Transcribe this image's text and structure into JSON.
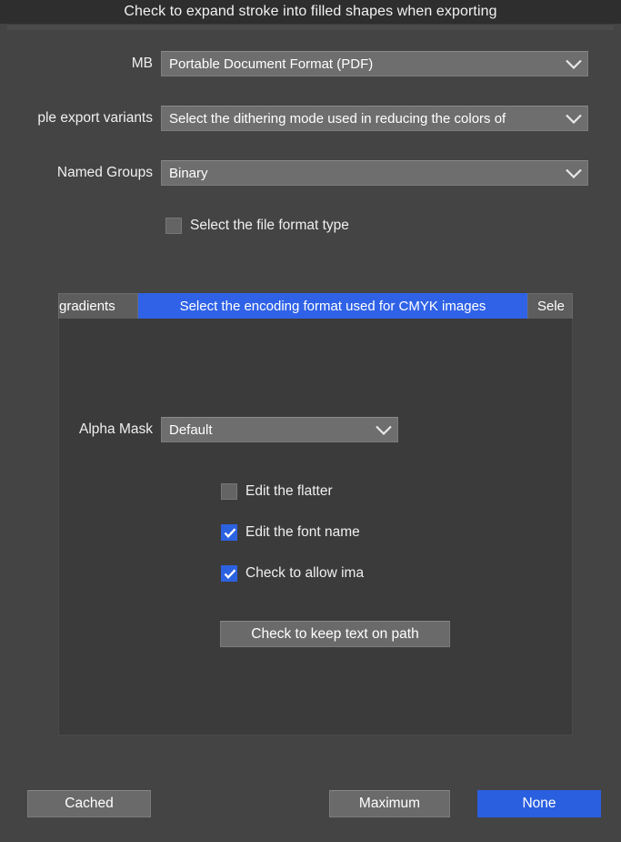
{
  "window": {
    "title": "Check to expand stroke into filled shapes when exporting"
  },
  "theme": {
    "background": "#444444",
    "titlebar_background": "#2e2e2e",
    "control_background": "#6e6e6e",
    "panel_background": "#3b3b3b",
    "accent": "#2a5fe0",
    "tab_active": "#2f62e6",
    "text": "#f0f0f0"
  },
  "form": {
    "rows": [
      {
        "label": "MB",
        "value": "Portable Document Format (PDF)",
        "icon": "chevron-down-icon"
      },
      {
        "label": "ple export variants",
        "value": "Select the dithering mode used in reducing the colors of",
        "icon": "chevron-down-icon"
      },
      {
        "label": "Named Groups",
        "value": "Binary",
        "icon": "chevron-down-icon"
      }
    ],
    "file_format_checkbox": {
      "label": "Select the file format type",
      "checked": false
    }
  },
  "panel": {
    "tabs": [
      {
        "label": "gradients",
        "active": false
      },
      {
        "label": "Select the encoding format used for CMYK images",
        "active": true
      },
      {
        "label": "Sele",
        "active": false
      }
    ],
    "alpha_mask": {
      "label": "Alpha Mask",
      "value": "Default",
      "icon": "chevron-down-icon"
    },
    "checkboxes": [
      {
        "label": "Edit the flatter",
        "checked": false
      },
      {
        "label": "Edit the font name",
        "checked": true
      },
      {
        "label": "Check to allow ima",
        "checked": true
      }
    ],
    "button": {
      "label": "Check to keep text on path"
    }
  },
  "footer": {
    "buttons": [
      {
        "label": "Cached",
        "accent": false
      },
      {
        "label": "Maximum",
        "accent": false
      },
      {
        "label": "None",
        "accent": true
      }
    ]
  }
}
